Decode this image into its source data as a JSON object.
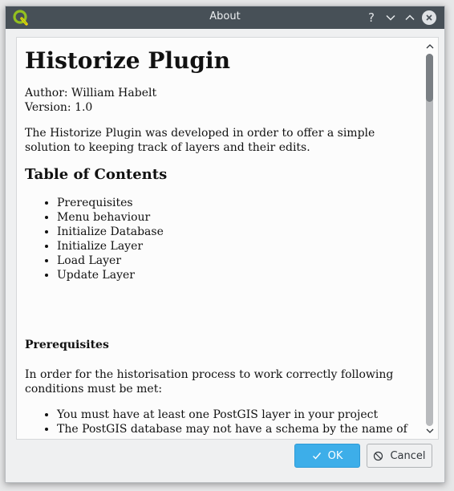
{
  "window": {
    "title": "About",
    "help_glyph": "?",
    "icons": {
      "app": "qgis-logo-icon",
      "help": "help-icon",
      "minimize": "chevron-down-icon",
      "maximize": "chevron-up-icon",
      "close": "close-icon"
    }
  },
  "doc": {
    "heading": "Historize Plugin",
    "author": "Author: William Habelt",
    "version": "Version: 1.0",
    "intro": "The Historize Plugin was developed in order to offer a simple solution to keeping track of layers and their edits.",
    "toc_heading": "Table of Contents",
    "toc": [
      "Prerequisites",
      "Menu behaviour",
      "Initialize Database",
      "Initialize Layer",
      "Load Layer",
      "Update Layer"
    ],
    "prereq_heading": "Prerequisites",
    "prereq_intro": "In order for the historisation process to work correctly following conditions must be met:",
    "prereq_items": [
      "You must have at least one PostGIS layer in your project",
      "The PostGIS database may not have a schema by the name of"
    ]
  },
  "scroll": {
    "position_fraction": 0.0
  },
  "buttons": {
    "ok_label": "OK",
    "cancel_label": "Cancel",
    "ok_icon": "check-icon",
    "cancel_icon": "cancel-icon"
  },
  "colors": {
    "titlebar": "#475057",
    "accent": "#3daee9"
  }
}
